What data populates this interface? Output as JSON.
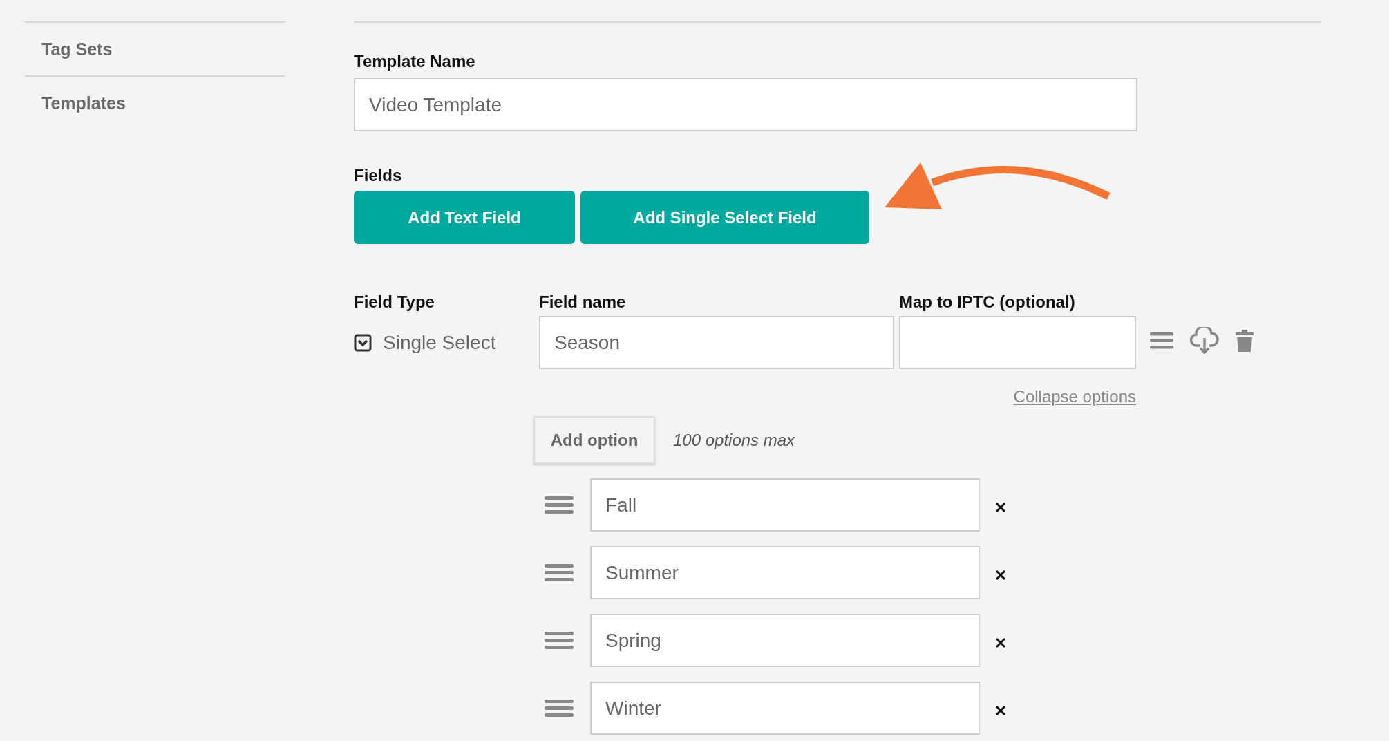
{
  "sidebar": {
    "items": [
      {
        "label": "Tag Sets",
        "selected": false
      },
      {
        "label": "Templates",
        "selected": false
      }
    ]
  },
  "template_name": {
    "label": "Template Name",
    "value": "Video Template"
  },
  "fields_section": {
    "heading": "Fields",
    "buttons": [
      "Add Text Field",
      "Add Single Select Field"
    ]
  },
  "field": {
    "columns": [
      "Field Type",
      "Field name",
      "Map to IPTC (optional)"
    ],
    "type_label": "Single Select",
    "expanded": true,
    "name": "Season",
    "collapse_link": "Collapse options",
    "add_option": "Add option",
    "max_note": "100 options max",
    "options": [
      {
        "value": "Fall"
      },
      {
        "value": "Summer"
      },
      {
        "value": "Spring"
      },
      {
        "value": "Winter"
      }
    ]
  }
}
